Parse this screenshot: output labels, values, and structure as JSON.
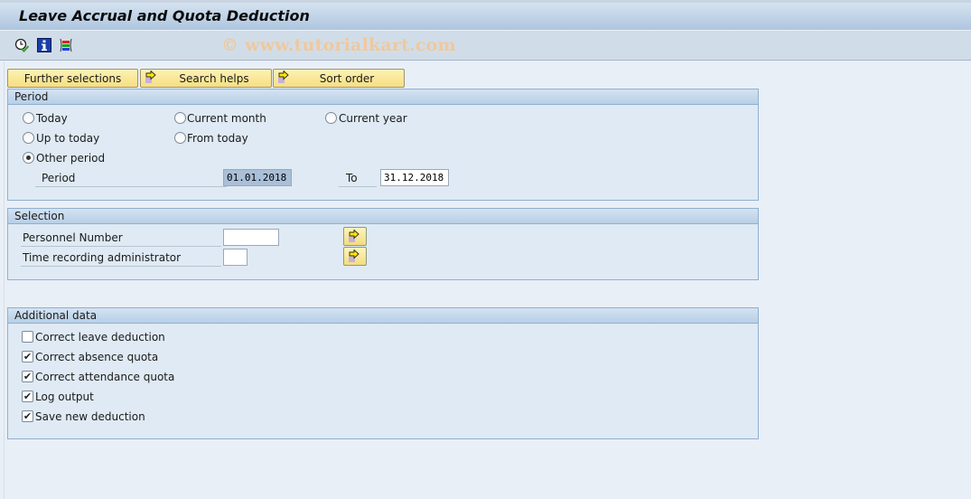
{
  "window": {
    "title": "Leave Accrual and Quota Deduction",
    "watermark": "© www.tutorialkart.com"
  },
  "toolbar": {
    "icons": [
      {
        "name": "execute-icon",
        "label": "Execute"
      },
      {
        "name": "info-icon",
        "label": "Information"
      },
      {
        "name": "selection-screen-icon",
        "label": "Selection screen"
      }
    ]
  },
  "tabs": [
    {
      "label": "Further selections"
    },
    {
      "label": "Search helps"
    },
    {
      "label": "Sort order"
    }
  ],
  "period": {
    "title": "Period",
    "options": [
      {
        "label": "Today",
        "selected": false
      },
      {
        "label": "Current month",
        "selected": false
      },
      {
        "label": "Current year",
        "selected": false
      },
      {
        "label": "Up to today",
        "selected": false
      },
      {
        "label": "From today",
        "selected": false
      },
      {
        "label": "Other period",
        "selected": true
      }
    ],
    "period_label": "Period",
    "from": "01.01.2018",
    "to_label": "To",
    "to": "31.12.2018"
  },
  "selection": {
    "title": "Selection",
    "fields": [
      {
        "label": "Personnel Number",
        "value": ""
      },
      {
        "label": "Time recording administrator",
        "value": ""
      }
    ]
  },
  "additional": {
    "title": "Additional data",
    "checks": [
      {
        "label": "Correct leave deduction",
        "checked": false
      },
      {
        "label": "Correct absence quota",
        "checked": true
      },
      {
        "label": "Correct attendance quota",
        "checked": true
      },
      {
        "label": "Log output",
        "checked": true
      },
      {
        "label": "Save new deduction",
        "checked": true
      }
    ]
  }
}
